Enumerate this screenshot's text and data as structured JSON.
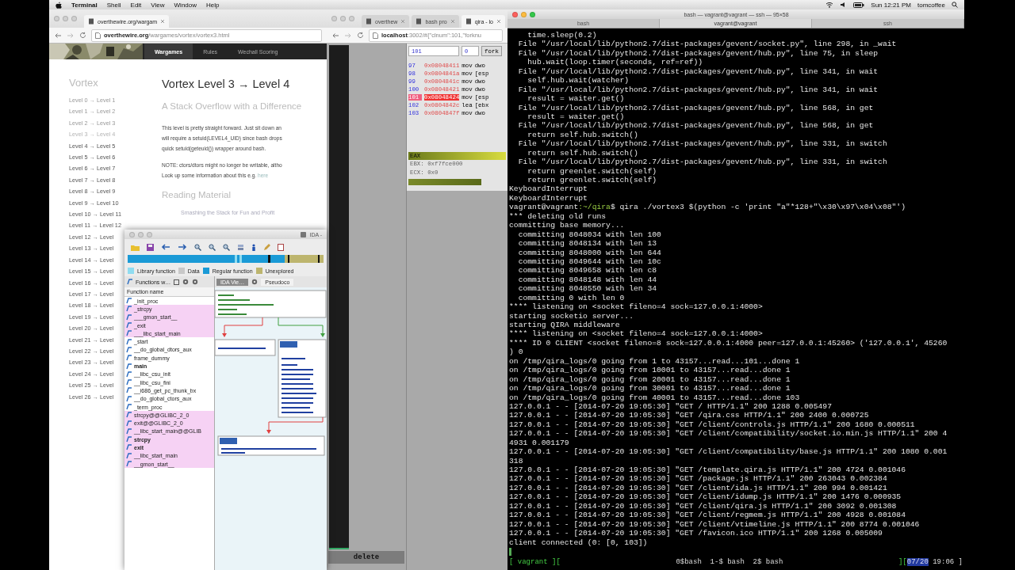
{
  "menubar": {
    "items": [
      {
        "label": "Terminal",
        "kind": "app"
      },
      {
        "label": "Shell",
        "kind": "menu"
      },
      {
        "label": "Edit",
        "kind": "menu"
      },
      {
        "label": "View",
        "kind": "menu"
      },
      {
        "label": "Window",
        "kind": "menu"
      },
      {
        "label": "Help",
        "kind": "menu"
      }
    ],
    "clock": "Sun 12:21 PM",
    "user": "tomcoffee"
  },
  "browser_left": {
    "tabs": [
      {
        "label": "overthewire.org/wargam",
        "selected": true
      }
    ],
    "url": "**overthewire.org**/wargames/vortex/vortex3.html",
    "nav": [
      {
        "label": "Wargames",
        "selected": true
      },
      {
        "label": "Rules",
        "selected": false
      },
      {
        "label": "Wechall Scoring",
        "selected": false
      }
    ],
    "sidebar": {
      "title": "Vortex",
      "items": [
        {
          "label": "Level 0 → Level 1",
          "visited": true,
          "selected": false
        },
        {
          "label": "Level 1 → Level 2",
          "visited": true,
          "selected": false
        },
        {
          "label": "Level 2 → Level 3",
          "visited": true,
          "selected": false
        },
        {
          "label": "Level 3 → Level 4",
          "visited": false,
          "selected": true
        },
        {
          "label": "Level 4 → Level 5",
          "visited": false,
          "selected": false
        },
        {
          "label": "Level 5 → Level 6",
          "visited": false,
          "selected": false
        },
        {
          "label": "Level 6 → Level 7",
          "visited": false,
          "selected": false
        },
        {
          "label": "Level 7 → Level 8",
          "visited": false,
          "selected": false
        },
        {
          "label": "Level 8 → Level 9",
          "visited": false,
          "selected": false
        },
        {
          "label": "Level 9 → Level 10",
          "visited": false,
          "selected": false
        },
        {
          "label": "Level 10 → Level 11",
          "visited": false,
          "selected": false
        },
        {
          "label": "Level 11 → Level 12",
          "visited": false,
          "selected": false
        },
        {
          "label": "Level 12 → Level",
          "visited": false,
          "selected": false
        },
        {
          "label": "Level 13 → Level",
          "visited": false,
          "selected": false
        },
        {
          "label": "Level 14 → Level",
          "visited": false,
          "selected": false
        },
        {
          "label": "Level 15 → Level",
          "visited": false,
          "selected": false
        },
        {
          "label": "Level 16 → Level",
          "visited": false,
          "selected": false
        },
        {
          "label": "Level 17 → Level",
          "visited": false,
          "selected": false
        },
        {
          "label": "Level 18 → Level",
          "visited": false,
          "selected": false
        },
        {
          "label": "Level 19 → Level",
          "visited": false,
          "selected": false
        },
        {
          "label": "Level 20 → Level",
          "visited": false,
          "selected": false
        },
        {
          "label": "Level 21 → Level",
          "visited": false,
          "selected": false
        },
        {
          "label": "Level 22 → Level",
          "visited": false,
          "selected": false
        },
        {
          "label": "Level 23 → Level",
          "visited": false,
          "selected": false
        },
        {
          "label": "Level 24 → Level",
          "visited": false,
          "selected": false
        },
        {
          "label": "Level 25 → Level",
          "visited": false,
          "selected": false
        },
        {
          "label": "Level 26 → Level",
          "visited": false,
          "selected": false
        }
      ]
    },
    "article": {
      "title": "Vortex Level 3 → Level 4",
      "subtitle": "A Stack Overflow with a Difference",
      "intro": [
        "This level is pretty straight forward. Just sit down an",
        "will require a setuid(LEVEL4_UID) since bash drops",
        "quick setuid(geteuid()) wrapper around bash."
      ],
      "note": "NOTE: ctors/dtors might no longer be writable, altho",
      "lookup": "Look up some information about this e.g.",
      "lookup_link": "here",
      "section": "Reading Material",
      "reading_link": "Smashing the Stack for Fun and Profit"
    }
  },
  "ida": {
    "title": "IDA -",
    "legend": [
      {
        "label": "Library function",
        "color": "#8fdcf0"
      },
      {
        "label": "Data",
        "color": "#c8c8c8"
      },
      {
        "label": "Regular function",
        "color": "#1a9ad6"
      },
      {
        "label": "Unexplored",
        "color": "#bdb56e"
      }
    ],
    "functions_title": "Functions w…",
    "column": "Function name",
    "functions": [
      {
        "name": "_init_proc",
        "highlighted": false,
        "bold": false
      },
      {
        "name": "_strcpy",
        "highlighted": true,
        "bold": false
      },
      {
        "name": "___gmon_start__",
        "highlighted": true,
        "bold": false
      },
      {
        "name": "_exit",
        "highlighted": true,
        "bold": false
      },
      {
        "name": "___libc_start_main",
        "highlighted": true,
        "bold": false
      },
      {
        "name": "_start",
        "highlighted": false,
        "bold": false
      },
      {
        "name": "__do_global_dtors_aux",
        "highlighted": false,
        "bold": false
      },
      {
        "name": "frame_dummy",
        "highlighted": false,
        "bold": false
      },
      {
        "name": "main",
        "highlighted": false,
        "bold": true
      },
      {
        "name": "__libc_csu_init",
        "highlighted": false,
        "bold": false
      },
      {
        "name": "__libc_csu_fini",
        "highlighted": false,
        "bold": false
      },
      {
        "name": "__i686_get_pc_thunk_bx",
        "highlighted": false,
        "bold": false
      },
      {
        "name": "__do_global_ctors_aux",
        "highlighted": false,
        "bold": false
      },
      {
        "name": "_term_proc",
        "highlighted": false,
        "bold": false
      },
      {
        "name": "strcpy@@GLIBC_2_0",
        "highlighted": true,
        "bold": false
      },
      {
        "name": "exit@@GLIBC_2_0",
        "highlighted": true,
        "bold": false
      },
      {
        "name": "__libc_start_main@@GLIB",
        "highlighted": true,
        "bold": false
      },
      {
        "name": "strcpy",
        "highlighted": true,
        "bold": true
      },
      {
        "name": "exit",
        "highlighted": true,
        "bold": true
      },
      {
        "name": "__libc_start_main",
        "highlighted": true,
        "bold": false
      },
      {
        "name": "__gmon_start__",
        "highlighted": true,
        "bold": false
      }
    ],
    "views": [
      {
        "label": "IDA Vie…",
        "selected": true
      },
      {
        "label": "Pseudoco",
        "selected": false
      }
    ]
  },
  "qira_browser": {
    "tabs": [
      {
        "label": "overthew",
        "selected": false
      },
      {
        "label": "bash pro",
        "selected": false
      },
      {
        "label": "qira - lo",
        "selected": true
      }
    ],
    "url": "**localhost**:3002/#{\"clnum\":101,\"forknu",
    "clnum_value": "101",
    "fork_value": "0",
    "fork_button": "fork",
    "instructions": [
      {
        "clnum": "97",
        "address": "0x08048411",
        "mnemonic": "mov",
        "operand": "dwo",
        "selected": false
      },
      {
        "clnum": "98",
        "address": "0x0804841a",
        "mnemonic": "mov",
        "operand": "[esp",
        "selected": false
      },
      {
        "clnum": "99",
        "address": "0x0804841c",
        "mnemonic": "mov",
        "operand": "dwo",
        "selected": false
      },
      {
        "clnum": "100",
        "address": "0x08048421",
        "mnemonic": "mov",
        "operand": "dwo",
        "selected": false
      },
      {
        "clnum": "101",
        "address": "0x08048424",
        "mnemonic": "mov",
        "operand": "[esp",
        "selected": true
      },
      {
        "clnum": "102",
        "address": "0x0804842c",
        "mnemonic": "lea",
        "operand": "[ebx",
        "selected": false
      },
      {
        "clnum": "103",
        "address": "0x0804847f",
        "mnemonic": "mov",
        "operand": "dwo",
        "selected": false
      }
    ],
    "register_bar": "EAX",
    "registers": [
      "EBX: 0xf7fce000",
      "ECX: 0x0"
    ],
    "delete_button": "delete"
  },
  "terminal": {
    "title": "bash — vagrant@vagrant — ssh — 95×58",
    "tabs": [
      {
        "label": "bash",
        "selected": false
      },
      {
        "label": "vagrant@vagrant",
        "selected": true
      },
      {
        "label": "ssh",
        "selected": false
      }
    ],
    "lines": [
      {
        "kind": "output",
        "text": "    time.sleep(0.2)"
      },
      {
        "kind": "output",
        "text": "  File \"/usr/local/lib/python2.7/dist-packages/gevent/socket.py\", line 298, in _wait"
      },
      {
        "kind": "output",
        "text": "  File \"/usr/local/lib/python2.7/dist-packages/gevent/hub.py\", line 75, in sleep"
      },
      {
        "kind": "output",
        "text": "    hub.wait(loop.timer(seconds, ref=ref))"
      },
      {
        "kind": "output",
        "text": "  File \"/usr/local/lib/python2.7/dist-packages/gevent/hub.py\", line 341, in wait"
      },
      {
        "kind": "output",
        "text": "    self.hub.wait(watcher)"
      },
      {
        "kind": "output",
        "text": "  File \"/usr/local/lib/python2.7/dist-packages/gevent/hub.py\", line 341, in wait"
      },
      {
        "kind": "output",
        "text": "    result = waiter.get()"
      },
      {
        "kind": "output",
        "text": "  File \"/usr/local/lib/python2.7/dist-packages/gevent/hub.py\", line 568, in get"
      },
      {
        "kind": "output",
        "text": "    result = waiter.get()"
      },
      {
        "kind": "output",
        "text": "  File \"/usr/local/lib/python2.7/dist-packages/gevent/hub.py\", line 568, in get"
      },
      {
        "kind": "output",
        "text": "    return self.hub.switch()"
      },
      {
        "kind": "output",
        "text": "  File \"/usr/local/lib/python2.7/dist-packages/gevent/hub.py\", line 331, in switch"
      },
      {
        "kind": "output",
        "text": "    return self.hub.switch()"
      },
      {
        "kind": "output",
        "text": "  File \"/usr/local/lib/python2.7/dist-packages/gevent/hub.py\", line 331, in switch"
      },
      {
        "kind": "output",
        "text": "    return greenlet.switch(self)"
      },
      {
        "kind": "output",
        "text": "    return greenlet.switch(self)"
      },
      {
        "kind": "output",
        "text": "KeyboardInterrupt"
      },
      {
        "kind": "output",
        "text": "KeyboardInterrupt"
      },
      {
        "kind": "prompt",
        "user": "vagrant@vagrant",
        "path": ":~/qira",
        "command": "$ qira ./vortex3 $(python -c 'print \"a\"*128+\"\\x30\\x97\\x04\\x08\"')"
      },
      {
        "kind": "output",
        "text": "*** deleting old runs"
      },
      {
        "kind": "output",
        "text": "committing base memory..."
      },
      {
        "kind": "output",
        "text": "  committing 8048034 with len 100"
      },
      {
        "kind": "output",
        "text": "  committing 8048134 with len 13"
      },
      {
        "kind": "output",
        "text": "  committing 8048000 with len 644"
      },
      {
        "kind": "output",
        "text": "  committing 8049644 with len 10c"
      },
      {
        "kind": "output",
        "text": "  committing 8049658 with len c8"
      },
      {
        "kind": "output",
        "text": "  committing 8048148 with len 44"
      },
      {
        "kind": "output",
        "text": "  committing 8048550 with len 34"
      },
      {
        "kind": "output",
        "text": "  committing 0 with len 0"
      },
      {
        "kind": "output",
        "text": "**** listening on <socket fileno=4 sock=127.0.0.1:4000>"
      },
      {
        "kind": "output",
        "text": "starting socketio server..."
      },
      {
        "kind": "output",
        "text": "starting QIRA middleware"
      },
      {
        "kind": "output",
        "text": "**** listening on <socket fileno=4 sock=127.0.0.1:4000>"
      },
      {
        "kind": "output",
        "text": "**** ID 0 CLIENT <socket fileno=8 sock=127.0.0.1:4000 peer=127.0.0.1:45260> ('127.0.0.1', 45260"
      },
      {
        "kind": "output",
        "text": ") 0"
      },
      {
        "kind": "output",
        "text": "on /tmp/qira_logs/0 going from 1 to 43157...read...101...done 1"
      },
      {
        "kind": "output",
        "text": "on /tmp/qira_logs/0 going from 10001 to 43157...read...done 1"
      },
      {
        "kind": "output",
        "text": "on /tmp/qira_logs/0 going from 20001 to 43157...read...done 1"
      },
      {
        "kind": "output",
        "text": "on /tmp/qira_logs/0 going from 30001 to 43157...read...done 1"
      },
      {
        "kind": "output",
        "text": "on /tmp/qira_logs/0 going from 40001 to 43157...read...done 103"
      },
      {
        "kind": "output",
        "text": "127.0.0.1 - - [2014-07-20 19:05:30] \"GET / HTTP/1.1\" 200 1288 0.005497"
      },
      {
        "kind": "output",
        "text": "127.0.0.1 - - [2014-07-20 19:05:30] \"GET /qira.css HTTP/1.1\" 200 2400 0.000725"
      },
      {
        "kind": "output",
        "text": "127.0.0.1 - - [2014-07-20 19:05:30] \"GET /client/controls.js HTTP/1.1\" 200 1680 0.000511"
      },
      {
        "kind": "output",
        "text": "127.0.0.1 - - [2014-07-20 19:05:30] \"GET /client/compatibility/socket.io.min.js HTTP/1.1\" 200 4"
      },
      {
        "kind": "output",
        "text": "4931 0.001179"
      },
      {
        "kind": "output",
        "text": "127.0.0.1 - - [2014-07-20 19:05:30] \"GET /client/compatibility/base.js HTTP/1.1\" 200 1080 0.001"
      },
      {
        "kind": "output",
        "text": "318"
      },
      {
        "kind": "output",
        "text": "127.0.0.1 - - [2014-07-20 19:05:30] \"GET /template.qira.js HTTP/1.1\" 200 4724 0.001046"
      },
      {
        "kind": "output",
        "text": "127.0.0.1 - - [2014-07-20 19:05:30] \"GET /package.js HTTP/1.1\" 200 263043 0.002384"
      },
      {
        "kind": "output",
        "text": "127.0.0.1 - - [2014-07-20 19:05:30] \"GET /client/ida.js HTTP/1.1\" 200 994 0.001421"
      },
      {
        "kind": "output",
        "text": "127.0.0.1 - - [2014-07-20 19:05:30] \"GET /client/idump.js HTTP/1.1\" 200 1476 0.000935"
      },
      {
        "kind": "output",
        "text": "127.0.0.1 - - [2014-07-20 19:05:30] \"GET /client/qira.js HTTP/1.1\" 200 3092 0.001308"
      },
      {
        "kind": "output",
        "text": "127.0.0.1 - - [2014-07-20 19:05:30] \"GET /client/regmem.js HTTP/1.1\" 200 4928 0.001084"
      },
      {
        "kind": "output",
        "text": "127.0.0.1 - - [2014-07-20 19:05:30] \"GET /client/vtimeline.js HTTP/1.1\" 200 8774 0.001046"
      },
      {
        "kind": "output",
        "text": "127.0.0.1 - - [2014-07-20 19:05:30] \"GET /favicon.ico HTTP/1.1\" 200 1268 0.005009"
      },
      {
        "kind": "output",
        "text": "client connected (0: [0, 103])"
      }
    ],
    "status": {
      "session": "[ vagrant ][",
      "windows": "0$bash  1-$ bash  2$ bash",
      "right": "][",
      "date": "07/20",
      "time": "19:06 ]"
    }
  }
}
